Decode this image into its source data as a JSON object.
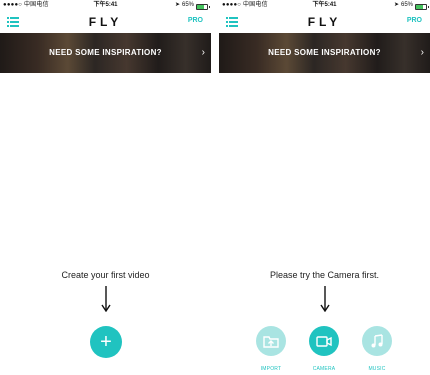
{
  "status_bar": {
    "carrier": "●●●●○ 中国电信",
    "time": "下午5:41",
    "battery_percent": "65%",
    "battery_level": 0.65
  },
  "nav": {
    "logo": "FLY",
    "pro_label": "PRO",
    "menu_icon": "menu-icon"
  },
  "banner": {
    "title": "NEED SOME INSPIRATION?",
    "chevron": "›"
  },
  "left_screen": {
    "prompt": "Create your first video",
    "add_button_label": "+"
  },
  "right_screen": {
    "prompt": "Please try the Camera first.",
    "actions": [
      {
        "label": "IMPORT",
        "icon": "folder-icon"
      },
      {
        "label": "CAMERA",
        "icon": "camera-icon"
      },
      {
        "label": "MUSIC",
        "icon": "music-icon"
      }
    ]
  },
  "colors": {
    "accent": "#20c3c0",
    "accent_light": "#a9e4e2",
    "text": "#222222"
  }
}
